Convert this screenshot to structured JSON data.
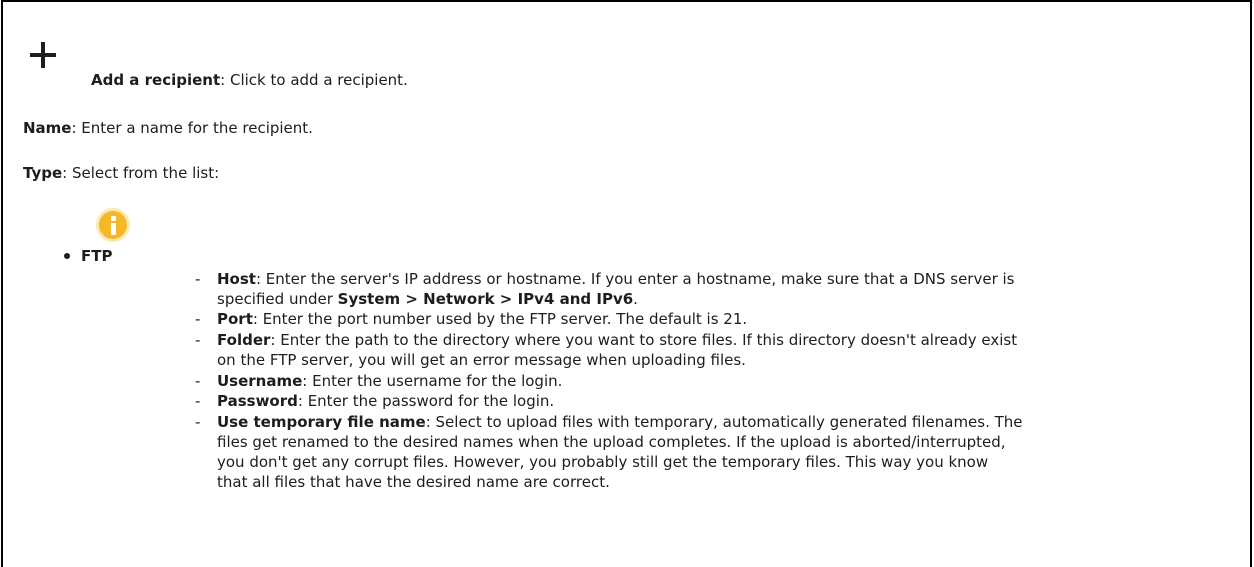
{
  "add_recipient": {
    "label": "Add a recipient",
    "text": ": Click to add a recipient."
  },
  "name": {
    "label": "Name",
    "text": ": Enter a name for the recipient."
  },
  "type": {
    "label": "Type",
    "text": ": Select from the list:"
  },
  "ftp": {
    "label": "FTP",
    "info_color": "#f5b829"
  },
  "items": [
    {
      "label": "Host",
      "text": ": Enter the server's IP address or hostname. If you enter a hostname, make sure that a DNS server is",
      "text2": "specified under ",
      "path": "System > Network > IPv4 and IPv6",
      "end": "."
    },
    {
      "label": "Port",
      "text": ": Enter the port number used by the FTP server. The default is 21."
    },
    {
      "label": "Folder",
      "text": ": Enter the path to the directory where you want to store files. If this directory doesn't already exist",
      "text2": "on the FTP server, you will get an error message when uploading files."
    },
    {
      "label": "Username",
      "text": ": Enter the username for the login."
    },
    {
      "label": "Password",
      "text": ": Enter the password for the login."
    },
    {
      "label": "Use temporary file name",
      "text": ": Select to upload files with temporary, automatically generated filenames. The",
      "text2": "files get renamed to the desired names when the upload completes. If the upload is aborted/interrupted,",
      "text3": "you don't get any corrupt files. However, you probably still get the temporary files. This way you know",
      "text4": "that all files that have the desired name are correct."
    }
  ],
  "dash": "-"
}
